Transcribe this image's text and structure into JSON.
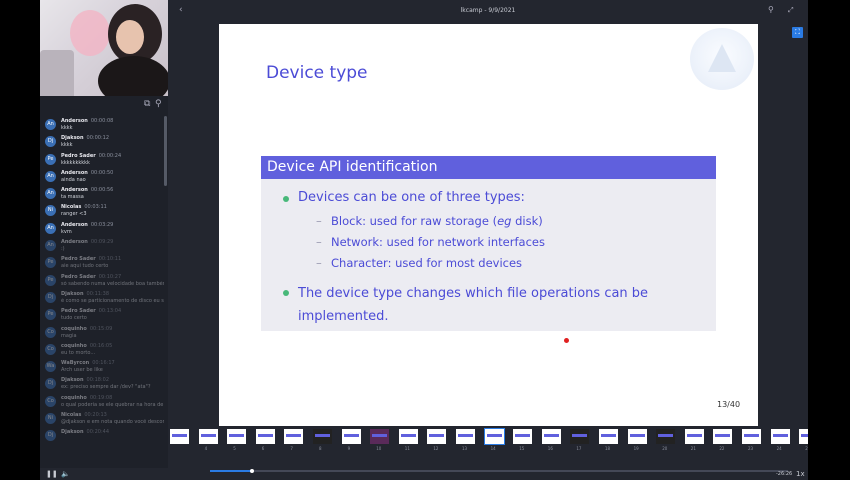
{
  "header": {
    "title": "lkcamp - 9/9/2021"
  },
  "chat": {
    "messages": [
      {
        "initials": "An",
        "name": "Anderson",
        "time": "00:00:08",
        "text": "kkkk",
        "color": "#3a6fb5"
      },
      {
        "initials": "Dj",
        "name": "Djakson",
        "time": "00:00:12",
        "text": "kkkk",
        "color": "#3a6fb5"
      },
      {
        "initials": "Pe",
        "name": "Pedro Sader",
        "time": "00:00:24",
        "text": "kkkkkkkkkk",
        "color": "#3a6fb5"
      },
      {
        "initials": "An",
        "name": "Anderson",
        "time": "00:00:50",
        "text": "ainda nao",
        "color": "#3a6fb5"
      },
      {
        "initials": "An",
        "name": "Anderson",
        "time": "00:00:56",
        "text": "ta massa",
        "color": "#3a6fb5"
      },
      {
        "initials": "Ni",
        "name": "Nicolas",
        "time": "00:03:11",
        "text": "ranger <3",
        "color": "#3a6fb5"
      },
      {
        "initials": "An",
        "name": "Anderson",
        "time": "00:03:29",
        "text": "kvm",
        "color": "#3a6fb5"
      },
      {
        "initials": "An",
        "name": "Anderson",
        "time": "00:09:29",
        "text": ":)",
        "color": "#3a6fb5"
      },
      {
        "initials": "Pe",
        "name": "Pedro Sader",
        "time": "00:10:11",
        "text": "aie aqui tudo certo",
        "color": "#3a6fb5"
      },
      {
        "initials": "Pe",
        "name": "Pedro Sader",
        "time": "00:10:27",
        "text": "só sabendo numa velocidade boa também, tá dando pra entender bem :)",
        "color": "#3a6fb5"
      },
      {
        "initials": "Dj",
        "name": "Djakson",
        "time": "00:11:38",
        "text": "é como se particionamento de disco eu ser só interno, conectando em 0?",
        "color": "#3a6fb5"
      },
      {
        "initials": "Pe",
        "name": "Pedro Sader",
        "time": "00:13:04",
        "text": "tudo certo",
        "color": "#3a6fb5"
      },
      {
        "initials": "Co",
        "name": "coquinho",
        "time": "00:15:09",
        "text": "magia",
        "color": "#3a6fb5"
      },
      {
        "initials": "Co",
        "name": "coquinho",
        "time": "00:16:05",
        "text": "eu to morto...",
        "color": "#3a6fb5"
      },
      {
        "initials": "Wa",
        "name": "WaByrcon",
        "time": "00:16:17",
        "text": "Arch user be like",
        "color": "#3a6fb5"
      },
      {
        "initials": "Dj",
        "name": "Djakson",
        "time": "00:18:02",
        "text": "ex: preciso sempre dar /dev? \"ata\"?",
        "color": "#3a6fb5"
      },
      {
        "initials": "Co",
        "name": "coquinho",
        "time": "00:19:08",
        "text": "o qual poderia se ele quebrar na hora de desconectar?",
        "color": "#3a6fb5"
      },
      {
        "initials": "Ni",
        "name": "Nicolas",
        "time": "00:20:13",
        "text": "@djakson e em nota quando você desconecta o módulo",
        "color": "#3a6fb5"
      },
      {
        "initials": "Dj",
        "name": "Djakson",
        "time": "00:20:44",
        "text": "",
        "color": "#3a6fb5"
      }
    ]
  },
  "slide": {
    "title": "Device type",
    "block_title": "Device API identification",
    "bullet1": "Devices can be one of three types:",
    "sub1_pre": "Block: used for raw storage (",
    "sub1_em": "eg",
    "sub1_post": " disk)",
    "sub2": "Network: used for network interfaces",
    "sub3": "Character: used for most devices",
    "bullet2_line1": "The device type changes which file operations can be",
    "bullet2_line2": "implemented.",
    "page": "13/40",
    "colors": {
      "title": "#4b4bd6",
      "block_head": "#6060dd",
      "block_body": "#ececf2",
      "bullet": "#48b87a"
    }
  },
  "thumbnails": [
    "",
    "4",
    "5",
    "6",
    "7",
    "8",
    "9",
    "10",
    "11",
    "12",
    "13",
    "14",
    "15",
    "16",
    "17",
    "18",
    "19",
    "20",
    "21",
    "22",
    "23",
    "24",
    "25"
  ],
  "player": {
    "time": "-26:26",
    "speed": "1x"
  },
  "icons": {
    "back": "chevron-left-icon",
    "search": "search-icon",
    "expand": "expand-icon",
    "fullscreen": "fullscreen-icon",
    "play": "pause-icon",
    "volume": "volume-icon"
  }
}
